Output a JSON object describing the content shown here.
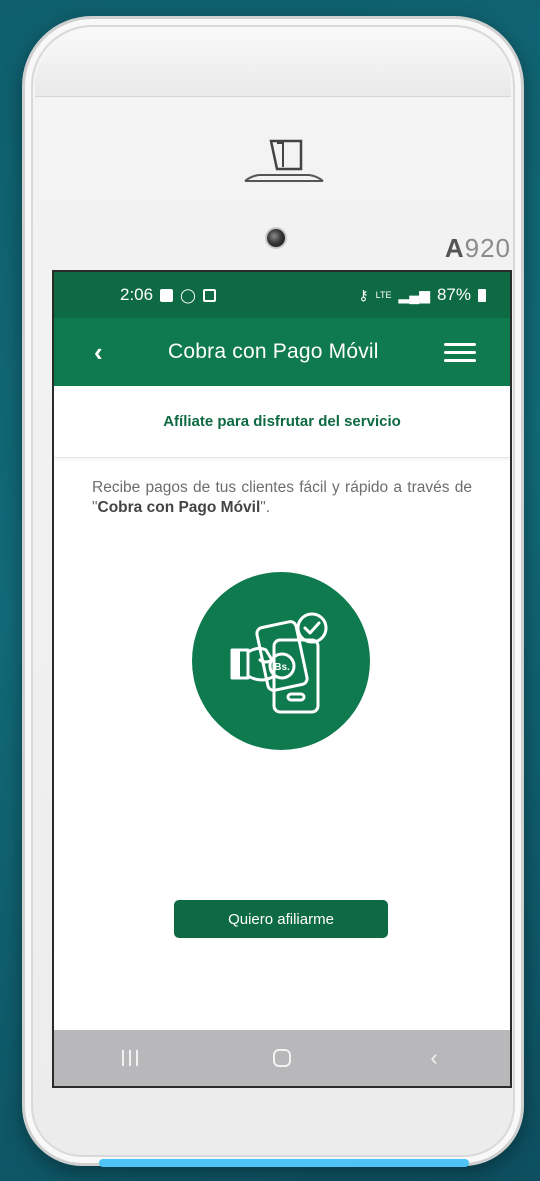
{
  "device": {
    "brand_bold": "A",
    "brand_rest": "920"
  },
  "status_bar": {
    "time": "2:06",
    "network": "LTE",
    "battery": "87%"
  },
  "app_bar": {
    "title": "Cobra con Pago Móvil",
    "back_icon": "chevron-left-icon",
    "menu_icon": "hamburger-menu-icon"
  },
  "subheader": {
    "text": "Afíliate para disfrutar del servicio"
  },
  "description": {
    "text_before": "Recibe pagos de tus clientes fácil y rápido a través de \"",
    "bold": "Cobra con Pago Móvil",
    "text_after": "\"."
  },
  "hero": {
    "icon": "mobile-payment-icon",
    "label": "Bs."
  },
  "cta": {
    "label": "Quiero afiliarme"
  },
  "nav": {
    "recent_icon": "recent-apps-icon",
    "home_icon": "home-icon",
    "back_icon": "back-icon"
  },
  "colors": {
    "primary": "#0e7a4e",
    "status_bar": "#0e6a43",
    "nav_bar": "#b8b8bb"
  }
}
